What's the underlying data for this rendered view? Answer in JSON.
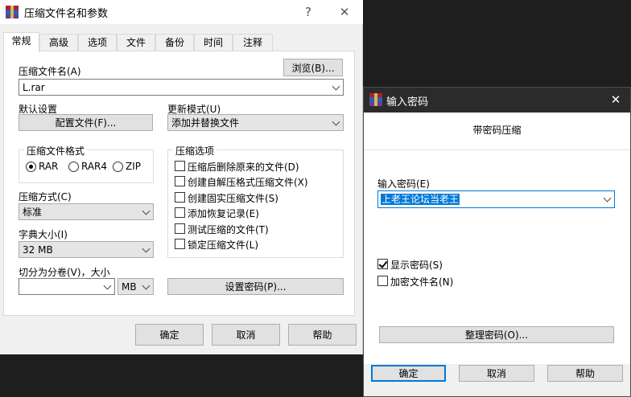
{
  "main_dialog": {
    "title": "压缩文件名和参数",
    "help_glyph": "?",
    "close_glyph": "✕",
    "tabs": [
      {
        "label": "常规",
        "active": true
      },
      {
        "label": "高级"
      },
      {
        "label": "选项"
      },
      {
        "label": "文件"
      },
      {
        "label": "备份"
      },
      {
        "label": "时间"
      },
      {
        "label": "注释"
      }
    ],
    "archive_name_label": "压缩文件名(A)",
    "browse_label": "浏览(B)...",
    "archive_name_value": "L.rar",
    "default_settings_label": "默认设置",
    "profiles_label": "配置文件(F)...",
    "update_mode_label": "更新模式(U)",
    "update_mode_value": "添加并替换文件",
    "format_group_title": "压缩文件格式",
    "formats": [
      {
        "label": "RAR",
        "selected": true
      },
      {
        "label": "RAR4",
        "selected": false
      },
      {
        "label": "ZIP",
        "selected": false
      }
    ],
    "options_group_title": "压缩选项",
    "options": [
      {
        "label": "压缩后删除原来的文件(D)",
        "checked": false
      },
      {
        "label": "创建自解压格式压缩文件(X)",
        "checked": false
      },
      {
        "label": "创建固实压缩文件(S)",
        "checked": false
      },
      {
        "label": "添加恢复记录(E)",
        "checked": false
      },
      {
        "label": "测试压缩的文件(T)",
        "checked": false
      },
      {
        "label": "锁定压缩文件(L)",
        "checked": false
      }
    ],
    "method_label": "压缩方式(C)",
    "method_value": "标准",
    "dict_label": "字典大小(I)",
    "dict_value": "32 MB",
    "split_label": "切分为分卷(V)，大小",
    "split_value": "",
    "split_unit": "MB",
    "set_password_label": "设置密码(P)...",
    "ok_label": "确定",
    "cancel_label": "取消",
    "help_label": "帮助"
  },
  "password_dialog": {
    "title": "输入密码",
    "close_glyph": "✕",
    "heading": "带密码压缩",
    "enter_password_label": "输入密码(E)",
    "password_value": "上老王论坛当老王",
    "show_password_label": "显示密码(S)",
    "show_password_checked": true,
    "encrypt_names_label": "加密文件名(N)",
    "encrypt_names_checked": false,
    "organize_label": "整理密码(O)...",
    "ok_label": "确定",
    "cancel_label": "取消",
    "help_label": "帮助"
  },
  "colors": {
    "accent": "#0078d7",
    "dark_titlebar": "#2b2b2b",
    "dialog_bg": "#f0f0f0"
  },
  "icons": {
    "app": "winrar-books-icon",
    "dropdown": "chevron-down-icon",
    "close": "close-icon",
    "help": "help-icon"
  }
}
